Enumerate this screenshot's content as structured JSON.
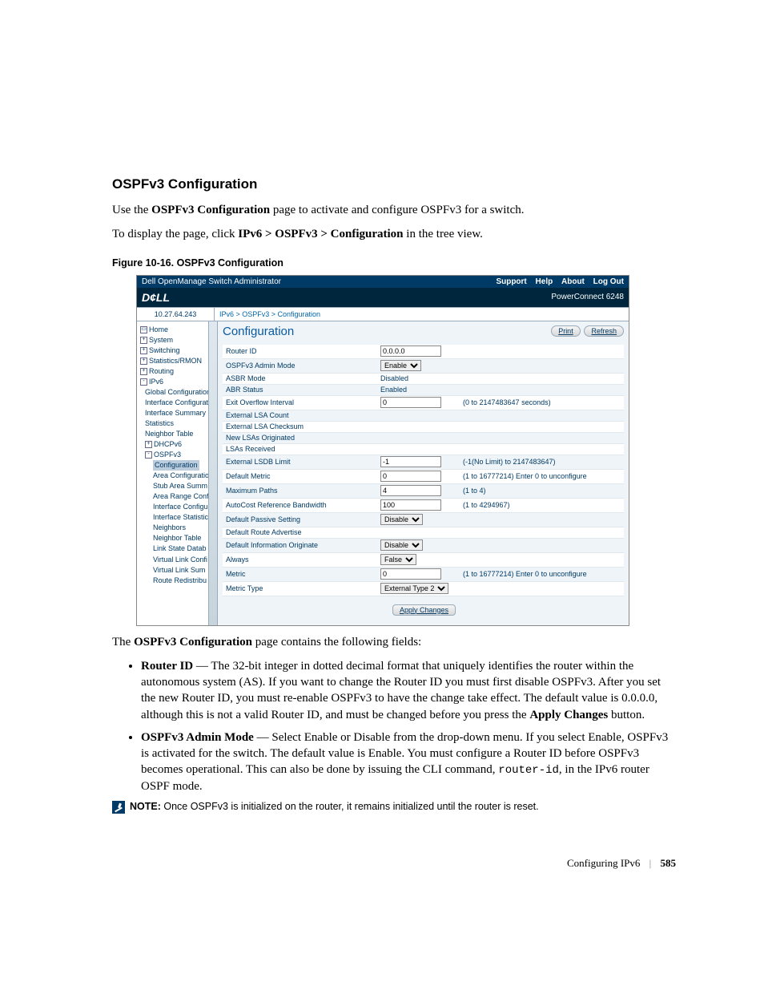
{
  "heading": "OSPFv3 Configuration",
  "intro_pre": "Use the ",
  "intro_bold": "OSPFv3 Configuration",
  "intro_post": " page to activate and configure OSPFv3 for a switch.",
  "display_pre": "To display the page, click ",
  "display_bold": "IPv6 > OSPFv3 > Configuration",
  "display_post": " in the tree view.",
  "figcap": "Figure 10-16.    OSPFv3 Configuration",
  "app": {
    "title": "Dell OpenManage Switch Administrator",
    "nav": {
      "support": "Support",
      "help": "Help",
      "about": "About",
      "logout": "Log Out"
    },
    "logo": "D¢LL",
    "model": "PowerConnect 6248",
    "ip": "10.27.64.243",
    "crumb": "IPv6 > OSPFv3 > Configuration",
    "page_title": "Configuration",
    "print": "Print",
    "refresh": "Refresh",
    "apply": "Apply Changes"
  },
  "tree": {
    "home": "Home",
    "system": "System",
    "switching": "Switching",
    "stats": "Statistics/RMON",
    "routing": "Routing",
    "ipv6": "IPv6",
    "gconf": "Global Configuration",
    "iconf": "Interface Configurati",
    "isum": "Interface Summary",
    "statsn": "Statistics",
    "ntable": "Neighbor Table",
    "dhcp": "DHCPv6",
    "ospf": "OSPFv3",
    "conf": "Configuration",
    "areac": "Area Configuratio",
    "stub": "Stub Area Summ",
    "range": "Area Range Conf",
    "iconf2": "Interface Configu",
    "istat": "Interface Statistic",
    "neigh": "Neighbors",
    "ntable2": "Neighbor Table",
    "lsdb": "Link State Datab",
    "vlc": "Virtual Link Confi",
    "vls": "Virtual Link Sum",
    "redis": "Route Redistribu"
  },
  "form": {
    "router_id": {
      "label": "Router ID",
      "value": "0.0.0.0"
    },
    "admin_mode": {
      "label": "OSPFv3 Admin Mode",
      "value": "Enable"
    },
    "asbr_mode": {
      "label": "ASBR Mode",
      "value": "Disabled"
    },
    "abr_status": {
      "label": "ABR Status",
      "value": "Enabled"
    },
    "exit_overflow": {
      "label": "Exit Overflow Interval",
      "value": "0",
      "hint": "(0 to 2147483647 seconds)"
    },
    "ext_lsa_count": {
      "label": "External LSA Count",
      "value": ""
    },
    "ext_lsa_chk": {
      "label": "External LSA Checksum",
      "value": ""
    },
    "new_lsas": {
      "label": "New LSAs Originated",
      "value": ""
    },
    "lsas_recv": {
      "label": "LSAs Received",
      "value": ""
    },
    "lsdb_limit": {
      "label": "External LSDB Limit",
      "value": "-1",
      "hint": "(-1(No Limit) to 2147483647)"
    },
    "def_metric": {
      "label": "Default Metric",
      "value": "0",
      "hint": "(1 to 16777214) Enter 0 to unconfigure"
    },
    "max_paths": {
      "label": "Maximum Paths",
      "value": "4",
      "hint": "(1 to 4)"
    },
    "auto_bw": {
      "label": "AutoCost Reference Bandwidth",
      "value": "100",
      "hint": "(1 to 4294967)"
    },
    "passive": {
      "label": "Default Passive Setting",
      "value": "Disable"
    },
    "route_adv": {
      "label": "Default Route Advertise",
      "value": ""
    },
    "def_info": {
      "label": "Default Information Originate",
      "value": "Disable"
    },
    "always": {
      "label": "Always",
      "value": "False"
    },
    "metric": {
      "label": "Metric",
      "value": "0",
      "hint": "(1 to 16777214) Enter 0 to unconfigure"
    },
    "metric_type": {
      "label": "Metric Type",
      "value": "External Type 2"
    }
  },
  "after_intro_pre": "The ",
  "after_intro_bold": "OSPFv3 Configuration",
  "after_intro_post": " page contains the following fields:",
  "bullets": {
    "router_id_label": "Router ID",
    "router_id_text": " — The 32-bit integer in dotted decimal format that uniquely identifies the router within the autonomous system (AS). If you want to change the Router ID you must first disable OSPFv3. After you set the new Router ID, you must re-enable OSPFv3 to have the change take effect. The default value is 0.0.0.0, although this is not a valid Router ID, and must be changed before you press the ",
    "router_id_apply": "Apply Changes",
    "router_id_tail": " button.",
    "admin_label": "OSPFv3 Admin Mode",
    "admin_text1": " — Select Enable or Disable from the drop-down menu. If you select Enable, OSPFv3 is activated for the switch. The default value is Enable. You must configure a Router ID before OSPFv3 becomes operational. This can also be done by issuing the CLI command, ",
    "admin_code": "router-id",
    "admin_text2": ", in the IPv6 router OSPF mode."
  },
  "note_label": "NOTE:",
  "note_text": " Once OSPFv3 is initialized on the router, it remains initialized until the router is reset.",
  "footer_section": "Configuring IPv6",
  "footer_page": "585"
}
